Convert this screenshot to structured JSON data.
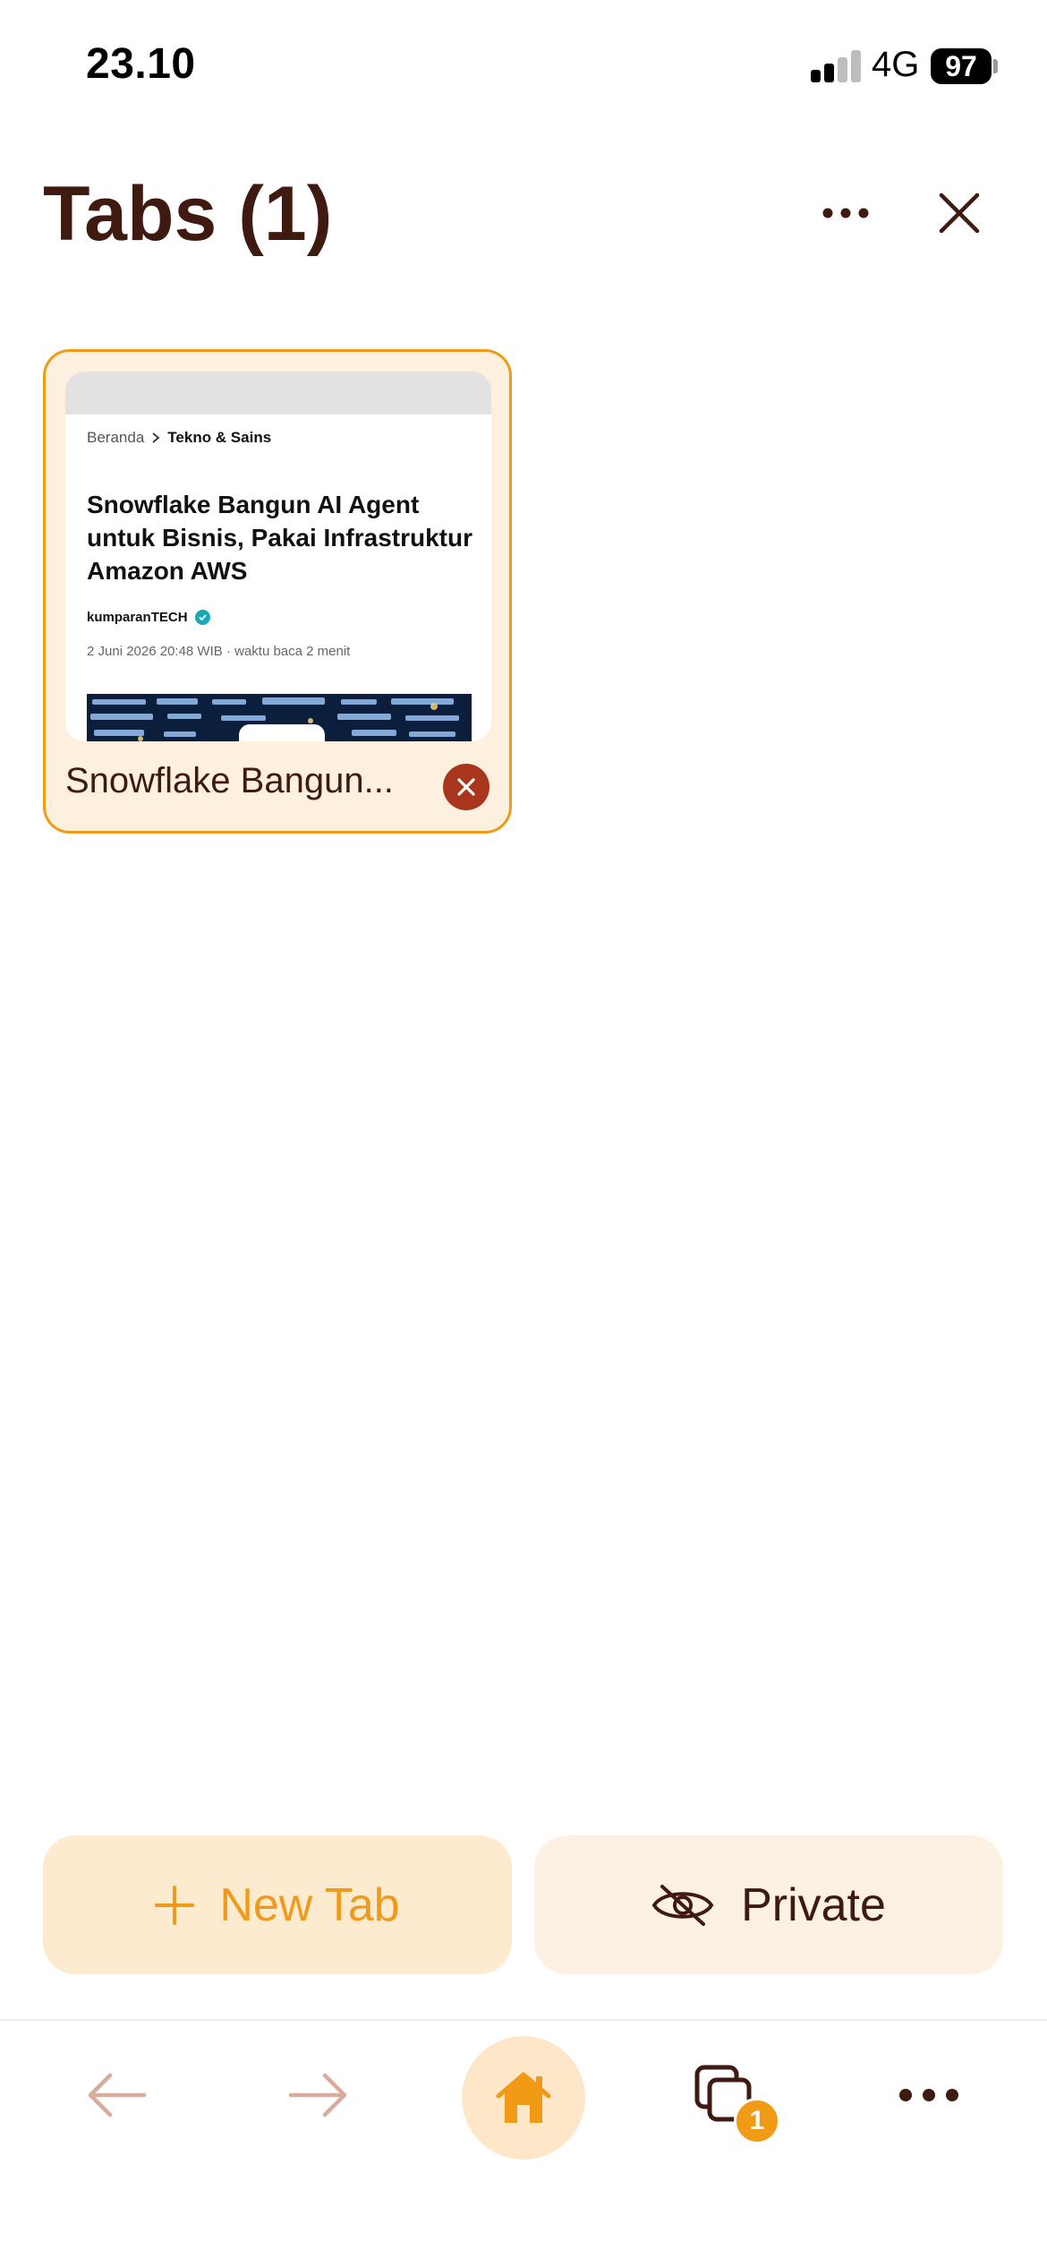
{
  "status_bar": {
    "time": "23.10",
    "network": "4G",
    "battery": "97"
  },
  "header": {
    "title": "Tabs (1)",
    "more_icon": "ellipsis-icon",
    "close_icon": "close-icon"
  },
  "tabs": [
    {
      "title": "Snowflake Bangun...",
      "preview": {
        "breadcrumb_home": "Beranda",
        "breadcrumb_section": "Tekno & Sains",
        "headline": "Snowflake Bangun AI Agent untuk Bisnis, Pakai Infrastruktur Amazon AWS",
        "author": "kumparanTECH",
        "meta": "2 Juni 2026 20:48 WIB · waktu baca 2 menit"
      }
    }
  ],
  "actions": {
    "new_tab": "New Tab",
    "private": "Private"
  },
  "toolbar": {
    "tabs_count": "1",
    "icons": [
      "back-arrow-icon",
      "forward-arrow-icon",
      "home-icon",
      "tabs-icon",
      "ellipsis-icon"
    ]
  },
  "colors": {
    "accent": "#f19a15",
    "text_dark": "#3f1a10",
    "card_bg": "#fdf0de",
    "close_red": "#a8361c",
    "nav_disabled": "#d8ab9c"
  }
}
